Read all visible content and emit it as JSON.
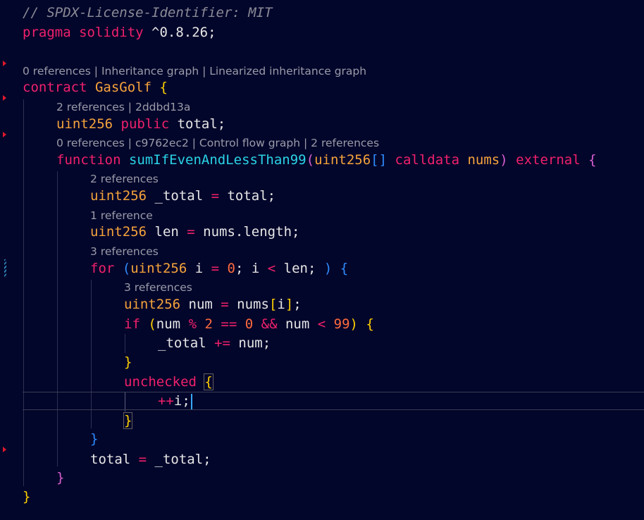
{
  "editor": {
    "language": "solidity",
    "lines": [
      {
        "tokens": [
          {
            "t": "// SPDX-License-Identifier: MIT",
            "c": "cm"
          }
        ]
      },
      {
        "tokens": [
          {
            "t": "pragma",
            "c": "kw"
          },
          {
            "t": " "
          },
          {
            "t": "solidity",
            "c": "kw"
          },
          {
            "t": " ^0.8.26;",
            "c": "dim"
          }
        ]
      },
      {
        "lens": "0 references | Inheritance graph | Linearized inheritance graph"
      },
      {
        "tokens": [
          {
            "t": "contract",
            "c": "kw"
          },
          {
            "t": " "
          },
          {
            "t": "GasGolf",
            "c": "ty"
          },
          {
            "t": " "
          },
          {
            "t": "{",
            "c": "b1"
          }
        ]
      },
      {
        "lens": "2 references | 2ddbd13a"
      },
      {
        "tokens": [
          {
            "t": "uint256",
            "c": "ty"
          },
          {
            "t": " "
          },
          {
            "t": "public",
            "c": "kw"
          },
          {
            "t": " total;",
            "c": "dim"
          }
        ]
      },
      {
        "lens": "0 references | c9762ec2 | Control flow graph | 2 references"
      },
      {
        "tokens": [
          {
            "t": "function",
            "c": "kw"
          },
          {
            "t": " "
          },
          {
            "t": "sumIfEvenAndLessThan99",
            "c": "fn"
          },
          {
            "t": "(",
            "c": "b2"
          },
          {
            "t": "uint256",
            "c": "ty"
          },
          {
            "t": "[]",
            "c": "b3"
          },
          {
            "t": " "
          },
          {
            "t": "calldata",
            "c": "kw"
          },
          {
            "t": " "
          },
          {
            "t": "nums",
            "c": "ty"
          },
          {
            "t": ")",
            "c": "b2"
          },
          {
            "t": " "
          },
          {
            "t": "external",
            "c": "kw"
          },
          {
            "t": " "
          },
          {
            "t": "{",
            "c": "b2"
          }
        ]
      },
      {
        "lens": "2 references"
      },
      {
        "tokens": [
          {
            "t": "uint256",
            "c": "ty"
          },
          {
            "t": " _total ",
            "c": "dim"
          },
          {
            "t": "=",
            "c": "op"
          },
          {
            "t": " total;",
            "c": "dim"
          }
        ]
      },
      {
        "lens": "1 reference"
      },
      {
        "tokens": [
          {
            "t": "uint256",
            "c": "ty"
          },
          {
            "t": " len ",
            "c": "dim"
          },
          {
            "t": "=",
            "c": "op"
          },
          {
            "t": " nums.length;",
            "c": "dim"
          }
        ]
      },
      {
        "lens": "3 references"
      },
      {
        "tokens": [
          {
            "t": "for",
            "c": "kw"
          },
          {
            "t": " "
          },
          {
            "t": "(",
            "c": "b3"
          },
          {
            "t": "uint256",
            "c": "ty"
          },
          {
            "t": " i ",
            "c": "dim"
          },
          {
            "t": "=",
            "c": "op"
          },
          {
            "t": " "
          },
          {
            "t": "0",
            "c": "num"
          },
          {
            "t": "; i ",
            "c": "dim"
          },
          {
            "t": "<",
            "c": "op"
          },
          {
            "t": " len; ",
            "c": "dim"
          },
          {
            "t": ")",
            "c": "b3"
          },
          {
            "t": " "
          },
          {
            "t": "{",
            "c": "b3"
          }
        ]
      },
      {
        "lens": "3 references"
      },
      {
        "tokens": [
          {
            "t": "uint256",
            "c": "ty"
          },
          {
            "t": " num ",
            "c": "dim"
          },
          {
            "t": "=",
            "c": "op"
          },
          {
            "t": " nums",
            "c": "dim"
          },
          {
            "t": "[",
            "c": "b1"
          },
          {
            "t": "i",
            "c": "dim"
          },
          {
            "t": "]",
            "c": "b1"
          },
          {
            "t": ";",
            "c": "dim"
          }
        ]
      },
      {
        "tokens": [
          {
            "t": "if",
            "c": "kw"
          },
          {
            "t": " "
          },
          {
            "t": "(",
            "c": "b1"
          },
          {
            "t": "num ",
            "c": "dim"
          },
          {
            "t": "%",
            "c": "op"
          },
          {
            "t": " "
          },
          {
            "t": "2",
            "c": "num"
          },
          {
            "t": " "
          },
          {
            "t": "==",
            "c": "op"
          },
          {
            "t": " "
          },
          {
            "t": "0",
            "c": "num"
          },
          {
            "t": " "
          },
          {
            "t": "&&",
            "c": "op"
          },
          {
            "t": " num ",
            "c": "dim"
          },
          {
            "t": "<",
            "c": "op"
          },
          {
            "t": " "
          },
          {
            "t": "99",
            "c": "num"
          },
          {
            "t": ")",
            "c": "b1"
          },
          {
            "t": " "
          },
          {
            "t": "{",
            "c": "b1"
          }
        ]
      },
      {
        "tokens": [
          {
            "t": "_total ",
            "c": "dim"
          },
          {
            "t": "+=",
            "c": "op"
          },
          {
            "t": " num;",
            "c": "dim"
          }
        ]
      },
      {
        "tokens": [
          {
            "t": "}",
            "c": "b1"
          }
        ]
      },
      {
        "tokens": [
          {
            "t": "unchecked",
            "c": "kw"
          },
          {
            "t": " "
          },
          {
            "t": "{",
            "c": "b1",
            "bm": true
          }
        ]
      },
      {
        "tokens": [
          {
            "t": "++",
            "c": "op"
          },
          {
            "t": "i;",
            "c": "dim"
          }
        ],
        "cursor": true
      },
      {
        "tokens": [
          {
            "t": "}",
            "c": "b1",
            "bm": true
          }
        ]
      },
      {
        "tokens": [
          {
            "t": "}",
            "c": "b3"
          }
        ]
      },
      {
        "tokens": [
          {
            "t": "total ",
            "c": "dim"
          },
          {
            "t": "=",
            "c": "op"
          },
          {
            "t": " _total;",
            "c": "dim"
          }
        ]
      },
      {
        "tokens": [
          {
            "t": "}",
            "c": "b2"
          }
        ]
      },
      {
        "tokens": [
          {
            "t": "}",
            "c": "b1"
          }
        ]
      }
    ]
  },
  "theme": {
    "background": "#03062b",
    "keyword": "#f0206b",
    "type": "#f5a33b",
    "function": "#2ad3e6",
    "number": "#ff6a3d",
    "comment": "#8a8a96",
    "bracket1": "#ffd000",
    "bracket2": "#d85fd0",
    "bracket3": "#2f8cff",
    "gutter_marker": "#e0182b"
  }
}
